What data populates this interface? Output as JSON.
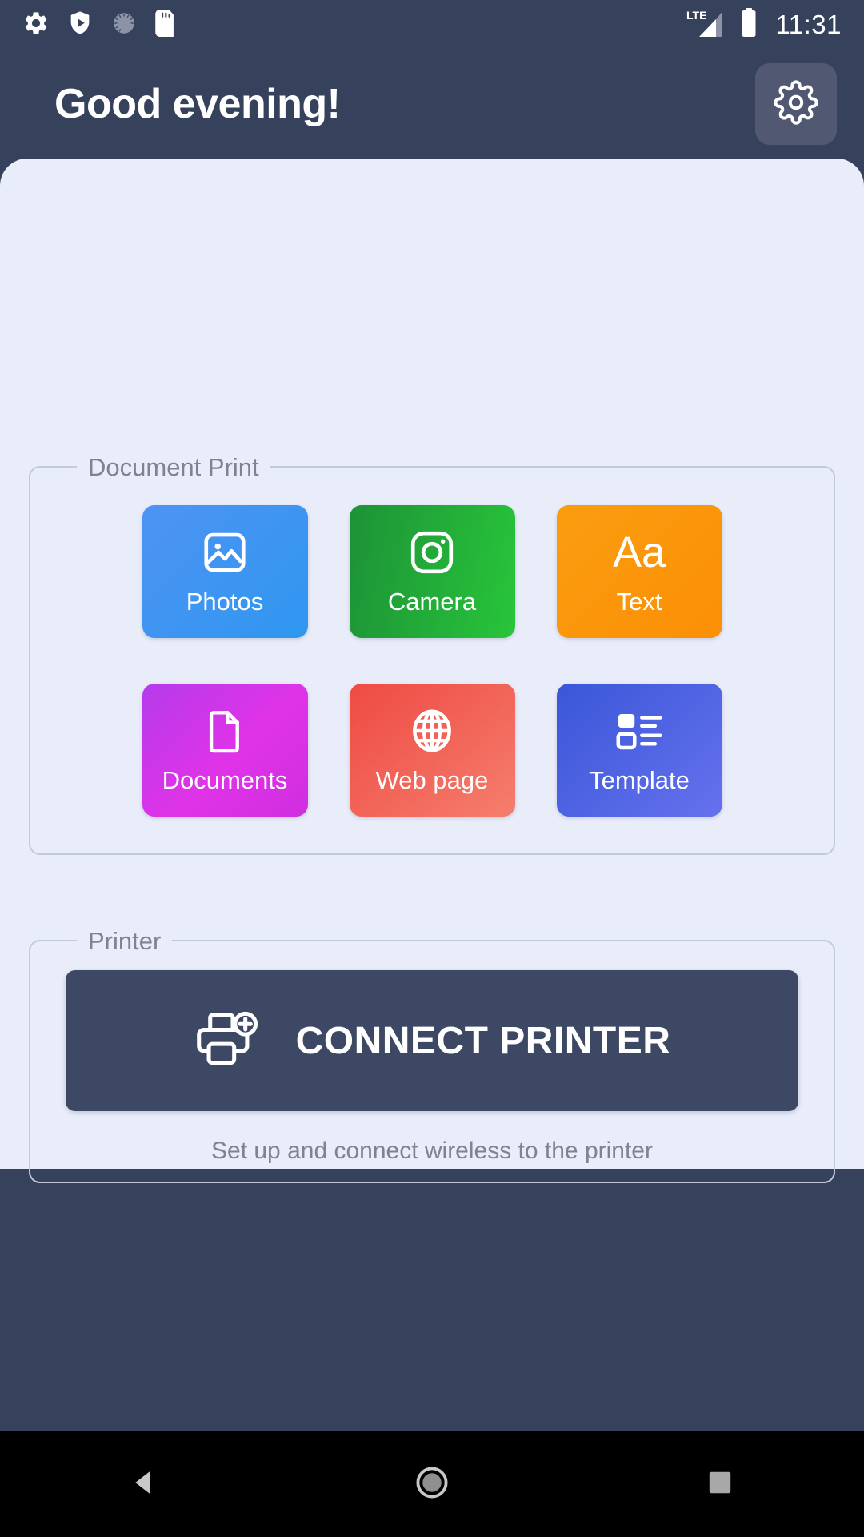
{
  "status_bar": {
    "time": "11:31",
    "left_icons": [
      {
        "name": "settings-gear-icon"
      },
      {
        "name": "play-protect-shield-icon"
      },
      {
        "name": "sync-spinner-icon"
      },
      {
        "name": "sd-card-icon"
      }
    ],
    "network_label": "LTE",
    "right_icons": [
      {
        "name": "lte-signal-icon"
      },
      {
        "name": "battery-full-icon"
      }
    ]
  },
  "header": {
    "greeting": "Good evening!",
    "settings_button": "settings-gear-icon"
  },
  "document_print": {
    "legend": "Document Print",
    "tiles": [
      {
        "label": "Photos",
        "icon": "image-icon",
        "color": "#3a90f2"
      },
      {
        "label": "Camera",
        "icon": "camera-icon",
        "color": "#23a935"
      },
      {
        "label": "Text",
        "icon": "aa-text-icon",
        "color": "#fb9407",
        "glyph": "Aa"
      },
      {
        "label": "Documents",
        "icon": "document-icon",
        "color": "#cf34e4"
      },
      {
        "label": "Web page",
        "icon": "globe-icon",
        "color": "#f1574c"
      },
      {
        "label": "Template",
        "icon": "template-icon",
        "color": "#4a60e0"
      }
    ]
  },
  "printer": {
    "legend": "Printer",
    "connect_label": "CONNECT PRINTER",
    "connect_icon": "printer-add-icon",
    "caption": "Set up and connect wireless to the printer"
  },
  "nav_bar": {
    "back": "back-triangle-icon",
    "home": "home-circle-icon",
    "recents": "recents-square-icon"
  },
  "colors": {
    "chrome": "#36415c",
    "sheet": "#e9edfa",
    "muted_text": "#7e8291",
    "button": "#3d4964"
  }
}
